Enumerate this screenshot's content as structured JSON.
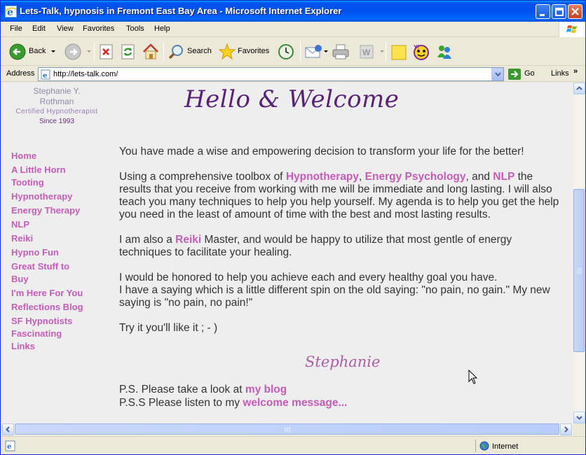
{
  "window": {
    "title": "Lets-Talk, hypnosis in Fremont East Bay Area - Microsoft Internet Explorer"
  },
  "menu": [
    "File",
    "Edit",
    "View",
    "Favorites",
    "Tools",
    "Help"
  ],
  "toolbar": {
    "back_label": "Back",
    "search_label": "Search",
    "favorites_label": "Favorites",
    "icons": [
      "back-icon",
      "forward-icon",
      "stop-icon",
      "refresh-icon",
      "home-icon",
      "search-icon",
      "favorites-star-icon",
      "history-icon",
      "mail-icon",
      "print-icon",
      "edit-word-icon",
      "notes-icon",
      "messenger-yahoo-icon",
      "msn-messenger-icon"
    ]
  },
  "address": {
    "label": "Address",
    "url": "http://lets-talk.com/",
    "go_label": "Go",
    "links_label": "Links",
    "links_chevron": "»"
  },
  "page": {
    "brand": {
      "name_line1": "Stephanie Y.",
      "name_line2": "Rothman",
      "title": "Certified Hypnotherapist",
      "since": "Since 1993"
    },
    "heading": "Hello & Welcome",
    "nav": [
      "Home",
      "A Little Horn",
      "Tooting",
      "Hypnotherapy",
      "Energy Therapy",
      "NLP",
      "Reiki",
      "Hypno Fun",
      "Great Stuff to",
      "Buy",
      "I'm Here For You",
      "Reflections Blog",
      "SF Hypnotists",
      "Fascinating",
      "Links"
    ],
    "p1": "You have made a wise and empowering decision to transform your life for the better!",
    "p2": {
      "a": "Using a comprehensive toolbox of ",
      "link1": "Hypnotherapy",
      "b": ", ",
      "link2": "Energy Psychology",
      "c": ", and ",
      "link3": "NLP",
      "d": " the results that you receive from working with me will be immediate and long lasting. I will also teach you many techniques to help you help yourself. My agenda is to help you get the help you need in the least of amount of time with the best and most lasting results."
    },
    "p3": {
      "a": "I am also a ",
      "link": "Reiki",
      "b": " Master, and would be happy to utilize that most gentle of energy techniques to facilitate your healing."
    },
    "p4_line1": "I would be honored to help you achieve each and every healthy goal you have.",
    "p4_line2": "I have a saying which is a little different spin on the old saying: \"no pain, no gain.\" My new saying is \"no pain, no pain!\"",
    "p5": "Try it you'll like it ; - )",
    "signature": "Stephanie",
    "ps1": {
      "text": "P.S. Please take a look at ",
      "link": "my blog"
    },
    "ps2": {
      "text": "P.S.S Please listen to my ",
      "link": "welcome message..."
    }
  },
  "status": {
    "zone": "Internet"
  },
  "colors": {
    "link": "#c65bb8",
    "heading": "#5a2178",
    "titlebar": "#0053ee"
  }
}
